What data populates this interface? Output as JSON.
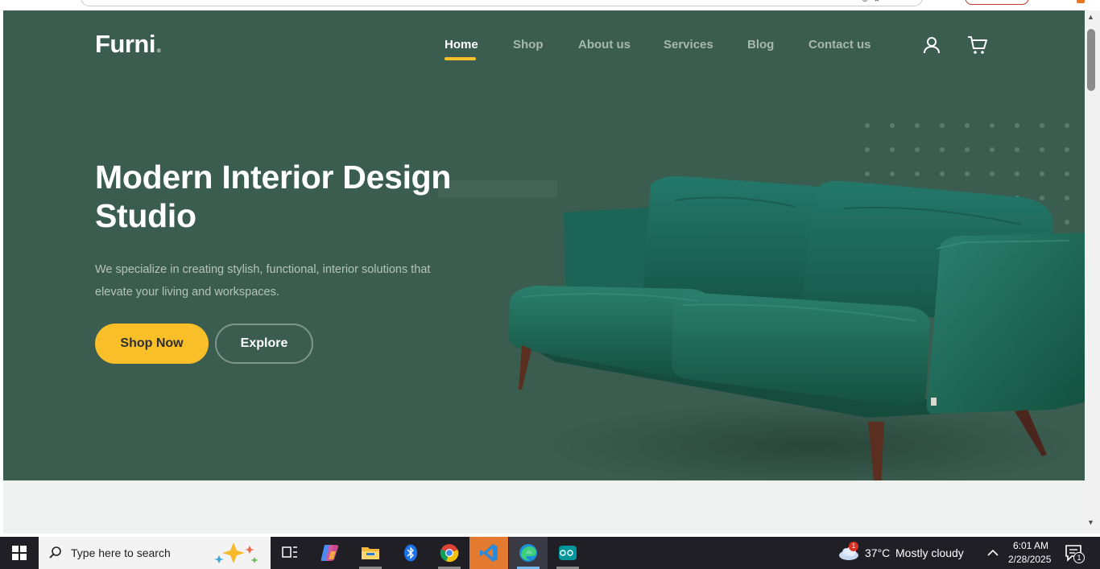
{
  "brand": {
    "name": "Furni",
    "dot": "."
  },
  "nav": {
    "items": [
      {
        "label": "Home",
        "active": true
      },
      {
        "label": "Shop",
        "active": false
      },
      {
        "label": "About us",
        "active": false
      },
      {
        "label": "Services",
        "active": false
      },
      {
        "label": "Blog",
        "active": false
      },
      {
        "label": "Contact us",
        "active": false
      }
    ],
    "icons": [
      "user-icon",
      "cart-icon"
    ]
  },
  "hero": {
    "title_line1": "Modern Interior Design",
    "title_line2": "Studio",
    "text_line1": "We specialize in creating stylish, functional, interior solutions that",
    "text_line2": "elevate your living and workspaces.",
    "primary_button": "Shop Now",
    "secondary_button": "Explore"
  },
  "colors": {
    "hero_bg": "#3b5d50",
    "accent": "#f9bf29",
    "sofa": "#1e6b57",
    "sofa_legs": "#5a2f22"
  },
  "taskbar": {
    "search_placeholder": "Type here to search",
    "apps": [
      "task-view-icon",
      "copilot-icon",
      "file-explorer-icon",
      "bluetooth-icon",
      "chrome-icon",
      "vscode-icon",
      "edge-icon",
      "arduino-icon"
    ],
    "active_app": "vscode-icon",
    "weather_temp": "37°C",
    "weather_desc": "Mostly cloudy",
    "weather_badge": "1",
    "time": "6:01 AM",
    "date": "2/28/2025",
    "notification_count": "1"
  }
}
